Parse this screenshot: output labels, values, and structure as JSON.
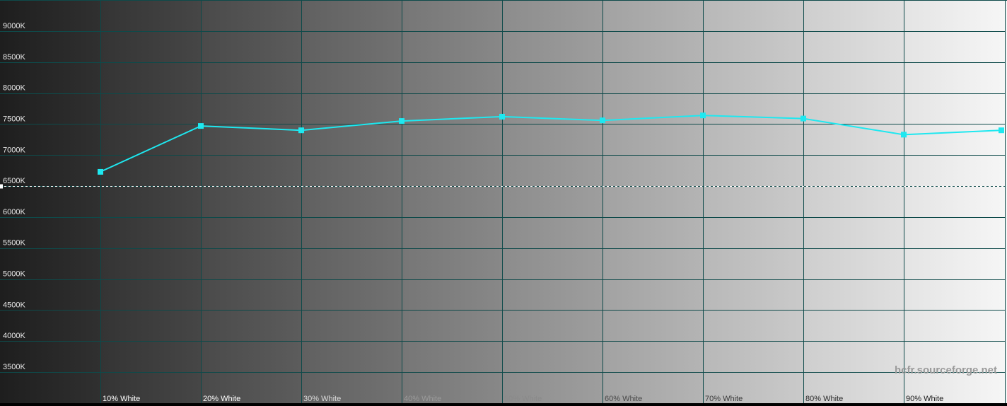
{
  "chart_data": {
    "type": "line",
    "y_unit": "K",
    "ylim": [
      3000,
      9400
    ],
    "y_ticks": [
      "9000K",
      "8500K",
      "8000K",
      "7500K",
      "7000K",
      "6500K",
      "6000K",
      "5500K",
      "5000K",
      "4500K",
      "4000K",
      "3500K"
    ],
    "y_tick_values": [
      9000,
      8500,
      8000,
      7500,
      7000,
      6500,
      6000,
      5500,
      5000,
      4500,
      4000,
      3500
    ],
    "categories": [
      "",
      "10% White",
      "20% White",
      "30% White",
      "40% White",
      "50% White",
      "60% White",
      "70% White",
      "80% White",
      "90% White",
      ""
    ],
    "x_labels_shown": [
      "10% White",
      "20% White",
      "30% White",
      "40% White",
      "50% White",
      "60% White",
      "70% White",
      "80% White",
      "90% White"
    ],
    "series": [
      {
        "values": [
          null,
          6730,
          7470,
          7400,
          7550,
          7620,
          7560,
          7640,
          7590,
          7330,
          7400
        ]
      }
    ],
    "reference_line": {
      "value": 6500,
      "style": "dashed"
    },
    "series_color": "#1ee8f0",
    "background": "grayscale gradient dark-to-light",
    "grid": true,
    "watermark": "hcfr.sourceforge.net"
  }
}
